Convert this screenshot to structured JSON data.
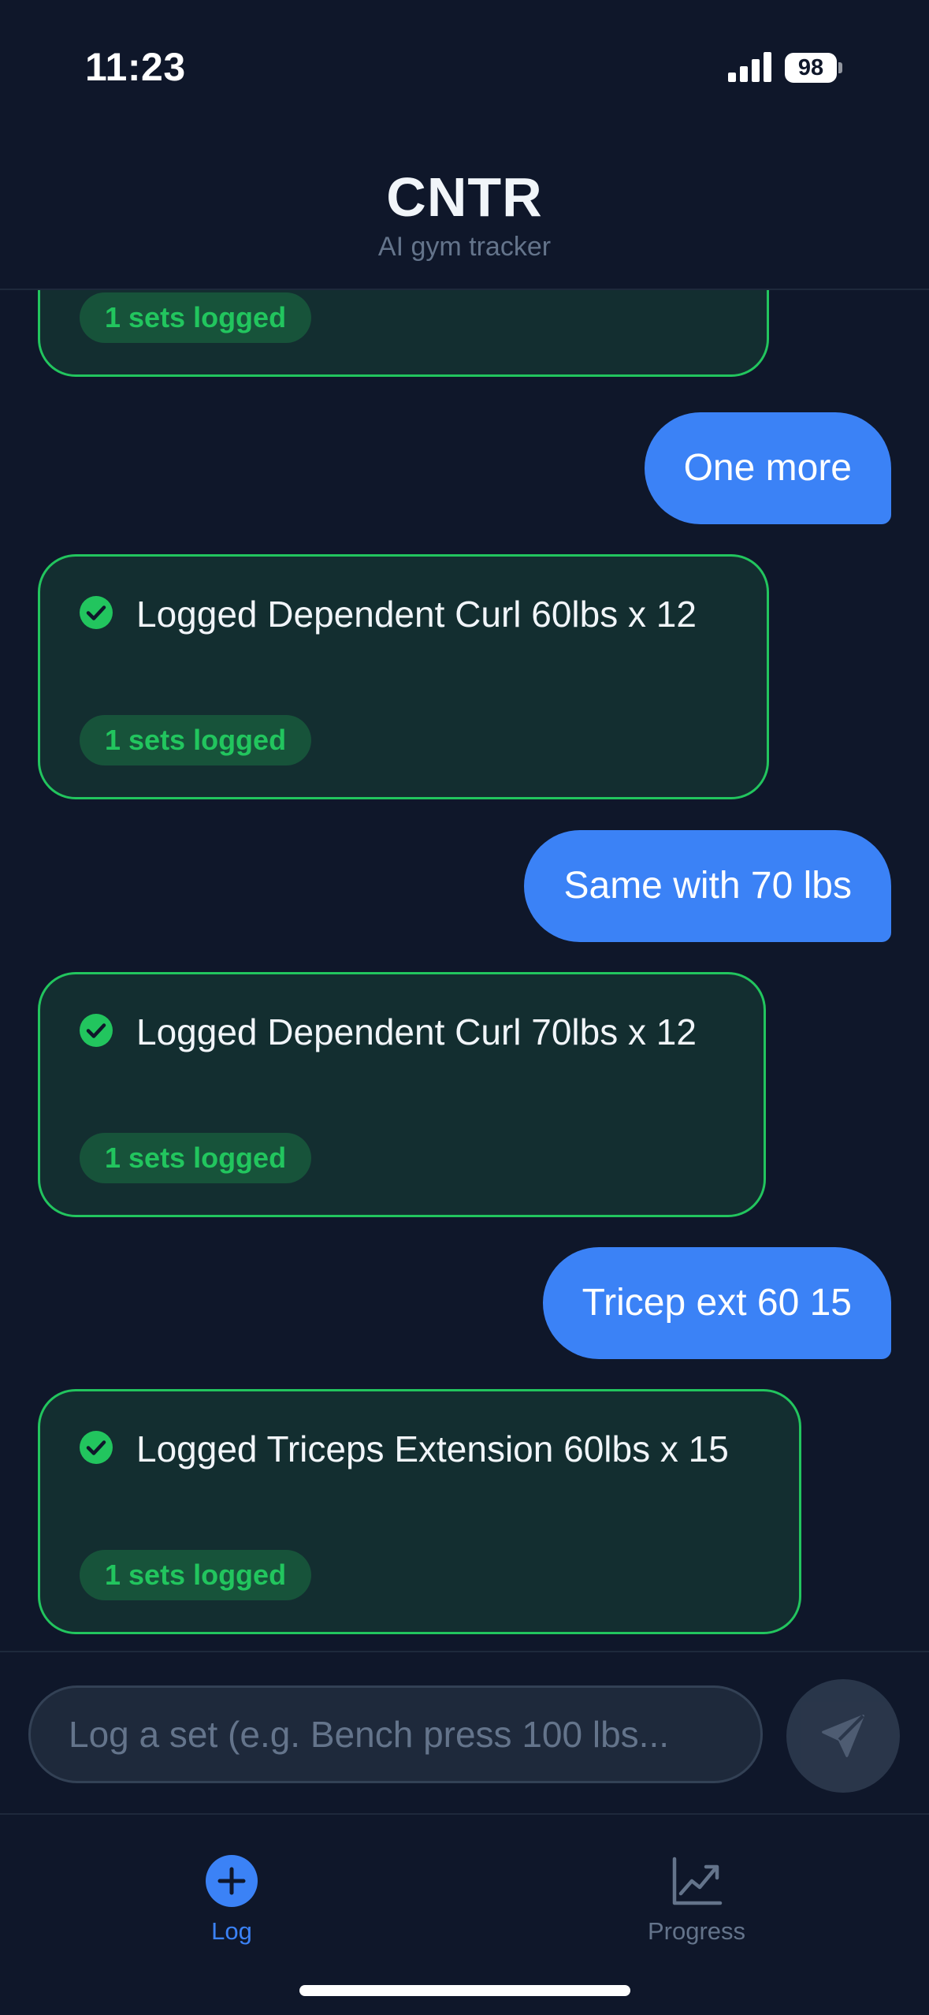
{
  "status_bar": {
    "time": "11:23",
    "battery": "98",
    "icons": [
      "signal-icon",
      "battery-icon"
    ]
  },
  "header": {
    "title": "CNTR",
    "subtitle": "AI gym tracker"
  },
  "chat": {
    "messages": [
      {
        "role": "bot",
        "text": "",
        "badge": "1 sets logged",
        "icon": "check-circle-icon"
      },
      {
        "role": "user",
        "text": "One more"
      },
      {
        "role": "bot",
        "text": "Logged Dependent Curl 60lbs x 12",
        "badge": "1 sets logged",
        "icon": "check-circle-icon"
      },
      {
        "role": "user",
        "text": "Same with 70 lbs"
      },
      {
        "role": "bot",
        "text": "Logged Dependent Curl 70lbs x 12",
        "badge": "1 sets logged",
        "icon": "check-circle-icon"
      },
      {
        "role": "user",
        "text": "Tricep ext 60 15"
      },
      {
        "role": "bot",
        "text": "Logged Triceps Extension 60lbs x 15",
        "badge": "1 sets logged",
        "icon": "check-circle-icon"
      }
    ]
  },
  "composer": {
    "placeholder": "Log a set (e.g. Bench press 100 lbs...",
    "value": "",
    "send_icon": "send-icon"
  },
  "nav": {
    "items": [
      {
        "label": "Log",
        "icon": "plus-circle-icon",
        "active": true
      },
      {
        "label": "Progress",
        "icon": "trending-up-icon",
        "active": false
      }
    ]
  },
  "colors": {
    "background": "#0f172a",
    "accent": "#3b82f6",
    "success": "#22c55e",
    "card": "#132e30",
    "muted": "#64748b"
  }
}
